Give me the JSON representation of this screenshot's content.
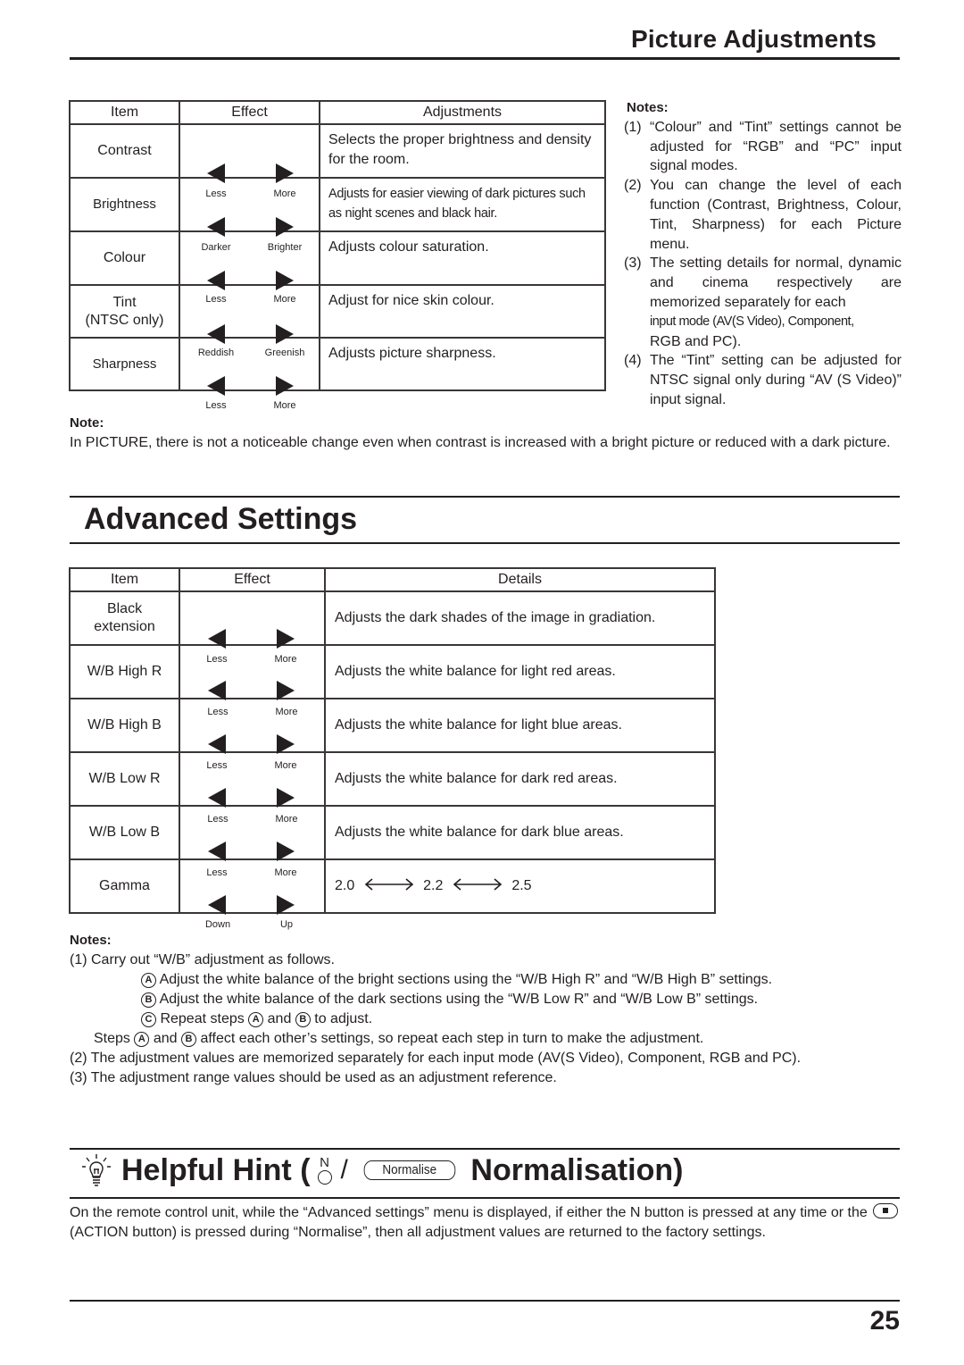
{
  "header": {
    "title": "Picture Adjustments"
  },
  "picture_table": {
    "headers": [
      "Item",
      "Effect",
      "Adjustments"
    ],
    "rows": [
      {
        "item": "Contrast",
        "left": "Less",
        "right": "More",
        "desc": "Selects the proper brightness and density for the room."
      },
      {
        "item": "Brightness",
        "left": "Darker",
        "right": "Brighter",
        "desc": "Adjusts for easier viewing of dark pictures such as night scenes and black hair."
      },
      {
        "item": "Colour",
        "left": "Less",
        "right": "More",
        "desc": "Adjusts colour saturation."
      },
      {
        "item": "Tint",
        "item2": "(NTSC only)",
        "left": "Reddish",
        "right": "Greenish",
        "desc": "Adjust for nice skin colour."
      },
      {
        "item": "Sharpness",
        "left": "Less",
        "right": "More",
        "desc": "Adjusts picture sharpness."
      }
    ]
  },
  "picture_notes": {
    "heading": "Notes:",
    "items": [
      {
        "num": "(1)",
        "text": "“Colour” and “Tint” settings cannot be adjusted for “RGB” and “PC” input signal modes."
      },
      {
        "num": "(2)",
        "text": "You can change the level of each function (Contrast, Brightness, Colour, Tint, Sharpness) for each Picture menu."
      },
      {
        "num": "(3)",
        "text": "The setting details for normal, dynamic and cinema respectively are memorized separately for each",
        "text_cond": "input mode (AV(S Video), Component,",
        "text_end": "RGB and PC)."
      },
      {
        "num": "(4)",
        "text": "The “Tint” setting can be adjusted for NTSC signal only during “AV (S Video)” input signal."
      }
    ]
  },
  "picture_note": {
    "heading": "Note:",
    "text": "In PICTURE, there is not a noticeable change even when contrast is increased with a bright picture or reduced with a dark picture."
  },
  "advanced": {
    "title": "Advanced Settings",
    "headers": [
      "Item",
      "Effect",
      "Details"
    ],
    "rows": [
      {
        "item": "Black",
        "item2": "extension",
        "left": "Less",
        "right": "More",
        "desc": "Adjusts the dark shades of the image in gradiation."
      },
      {
        "item": "W/B High R",
        "left": "Less",
        "right": "More",
        "desc": "Adjusts the white balance for light red areas."
      },
      {
        "item": "W/B High B",
        "left": "Less",
        "right": "More",
        "desc": "Adjusts the white balance for light blue areas."
      },
      {
        "item": "W/B Low R",
        "left": "Less",
        "right": "More",
        "desc": "Adjusts the white balance for dark red areas."
      },
      {
        "item": "W/B Low B",
        "left": "Less",
        "right": "More",
        "desc": "Adjusts the white balance for dark blue areas."
      },
      {
        "item": "Gamma",
        "left": "Down",
        "right": "Up",
        "gamma": [
          "2.0",
          "2.2",
          "2.5"
        ]
      }
    ],
    "notes": {
      "heading": "Notes:",
      "n1": "(1) Carry out “W/B” adjustment as follows.",
      "a_mark": "A",
      "a_text": "Adjust the white balance of the bright sections using the “W/B High R” and “W/B High B” settings.",
      "b_mark": "B",
      "b_text": "Adjust the white balance of the dark sections using the “W/B Low R” and “W/B Low B” settings.",
      "c_mark": "C",
      "c_text1": "Repeat steps",
      "c_and": "and",
      "c_text2": "to adjust.",
      "steps_1": "Steps",
      "steps_and": "and",
      "steps_2": "affect each other’s settings, so repeat each step in turn to make the adjustment.",
      "n2": "(2) The adjustment values are memorized separately for each input mode (AV(S Video), Component, RGB and PC).",
      "n3": "(3) The adjustment range values should be used as an adjustment reference."
    }
  },
  "hint": {
    "title_a": "Helpful Hint (",
    "n_label": "N",
    "slash": "/",
    "normalise_btn": "Normalise",
    "title_b": "Normalisation)",
    "body_1": "On the remote control unit, while the “Advanced settings” menu is displayed, if either the N button is pressed at any time or the",
    "body_2": "(ACTION button) is pressed during “Normalise”, then all adjustment values are returned to the factory settings."
  },
  "footer": {
    "page_number": "25"
  }
}
